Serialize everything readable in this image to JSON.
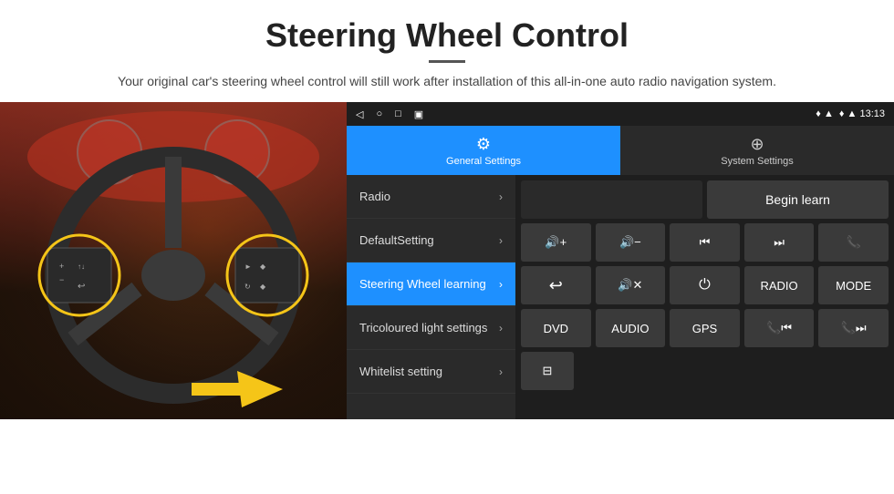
{
  "header": {
    "title": "Steering Wheel Control",
    "divider": true,
    "subtitle": "Your original car's steering wheel control will still work after installation of this all-in-one auto radio navigation system."
  },
  "status_bar": {
    "nav_icons": [
      "◁",
      "○",
      "□",
      "▣"
    ],
    "right_icons": "♦ ▲ 13:13"
  },
  "tabs": [
    {
      "id": "general",
      "label": "General Settings",
      "icon": "⚙",
      "active": true
    },
    {
      "id": "system",
      "label": "System Settings",
      "icon": "⊕",
      "active": false
    }
  ],
  "menu_items": [
    {
      "label": "Radio",
      "active": false
    },
    {
      "label": "DefaultSetting",
      "active": false
    },
    {
      "label": "Steering Wheel learning",
      "active": true
    },
    {
      "label": "Tricoloured light settings",
      "active": false
    },
    {
      "label": "Whitelist setting",
      "active": false
    }
  ],
  "right_panel": {
    "begin_learn_label": "Begin learn",
    "buttons_row1": [
      "🔊+",
      "🔊−",
      "⏮",
      "⏭",
      "📞"
    ],
    "buttons_row1_labels": [
      "vol_up",
      "vol_down",
      "prev",
      "next",
      "phone"
    ],
    "buttons_row2": [
      "↩",
      "🔊×",
      "⏻",
      "RADIO",
      "MODE"
    ],
    "buttons_row2_labels": [
      "back",
      "mute",
      "power",
      "radio",
      "mode"
    ],
    "buttons_row3": [
      "DVD",
      "AUDIO",
      "GPS",
      "📞⏮",
      "📞⏭"
    ],
    "buttons_row3_labels": [
      "dvd",
      "audio",
      "gps",
      "phone_prev",
      "phone_next"
    ],
    "buttons_row4": [
      "⊟"
    ],
    "buttons_row4_labels": [
      "list"
    ]
  },
  "arrow": "➜"
}
